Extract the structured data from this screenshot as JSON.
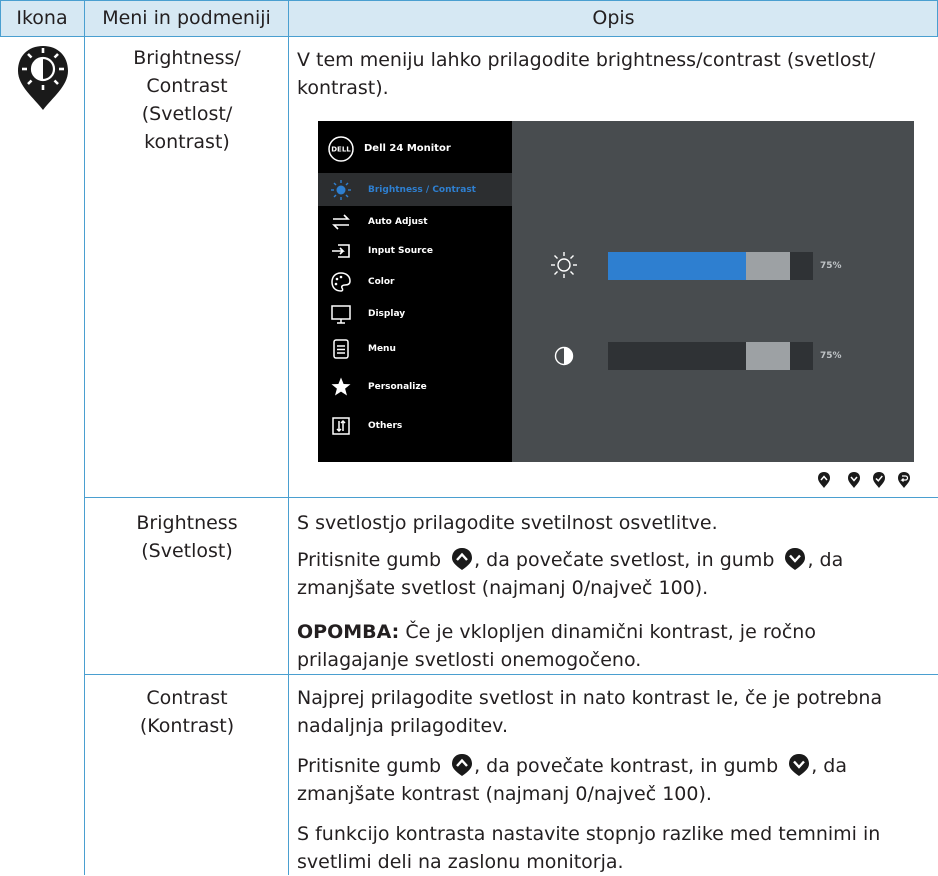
{
  "table": {
    "headers": {
      "icon": "Ikona",
      "menu": "Meni in podmeniji",
      "desc": "Opis"
    }
  },
  "icon": {
    "name": "brightness-pin-icon"
  },
  "row1": {
    "menu_lines": [
      "Brightness/",
      "Contrast",
      "(Svetlost/",
      "kontrast)"
    ],
    "desc_lines": [
      "V tem meniju lahko prilagodite brightness/contrast (svetlost/",
      "kontrast)."
    ]
  },
  "osd": {
    "title": "Dell 24 Monitor",
    "logo": "DELL",
    "items": [
      {
        "label": "Brightness / Contrast",
        "icon": "sun-icon",
        "selected": true
      },
      {
        "label": "Auto Adjust",
        "icon": "swap-arrows-icon"
      },
      {
        "label": "Input Source",
        "icon": "input-source-icon"
      },
      {
        "label": "Color",
        "icon": "palette-icon"
      },
      {
        "label": "Display",
        "icon": "monitor-icon"
      },
      {
        "label": "Menu",
        "icon": "menu-list-icon"
      },
      {
        "label": "Personalize",
        "icon": "star-icon"
      },
      {
        "label": "Others",
        "icon": "others-icon"
      }
    ],
    "brightness": {
      "value": 75,
      "label": "75%"
    },
    "contrast": {
      "value": 75,
      "label": "75%"
    },
    "colors": {
      "accent": "#2e7fd0",
      "bar_bg": "#2f3235",
      "slider": "#9da1a4"
    },
    "buttons": [
      "up-button-icon",
      "down-button-icon",
      "ok-button-icon",
      "back-button-icon"
    ]
  },
  "row2": {
    "menu_lines": [
      "Brightness",
      "(Svetlost)"
    ],
    "p1": "S svetlostjo prilagodite svetilnost osvetlitve.",
    "p2_a": "Pritisnite gumb",
    "p2_b": ", da povečate svetlost, in gumb",
    "p2_c": ", da",
    "p2_d": "zmanjšate svetlost (najmanj 0/največ 100).",
    "note_label": "OPOMBA:",
    "note_a": " Če je vklopljen dinamični kontrast, je ročno",
    "note_b": "prilagajanje svetlosti onemogočeno."
  },
  "row3": {
    "menu_lines": [
      "Contrast",
      "(Kontrast)"
    ],
    "p1_a": "Najprej prilagodite svetlost in nato kontrast le, če je potrebna",
    "p1_b": "nadaljnja prilagoditev.",
    "p2_a": "Pritisnite gumb",
    "p2_b": ", da povečate kontrast, in gumb",
    "p2_c": ", da",
    "p2_d": "zmanjšate kontrast (najmanj 0/največ 100).",
    "p3_a": "S funkcijo kontrasta nastavite stopnjo razlike med temnimi in",
    "p3_b": "svetlimi deli na zaslonu monitorja."
  },
  "colors": {
    "header_bg": "#d6e8f3",
    "rule": "#4a9fd0",
    "icon_fill": "#1a1a1a"
  }
}
